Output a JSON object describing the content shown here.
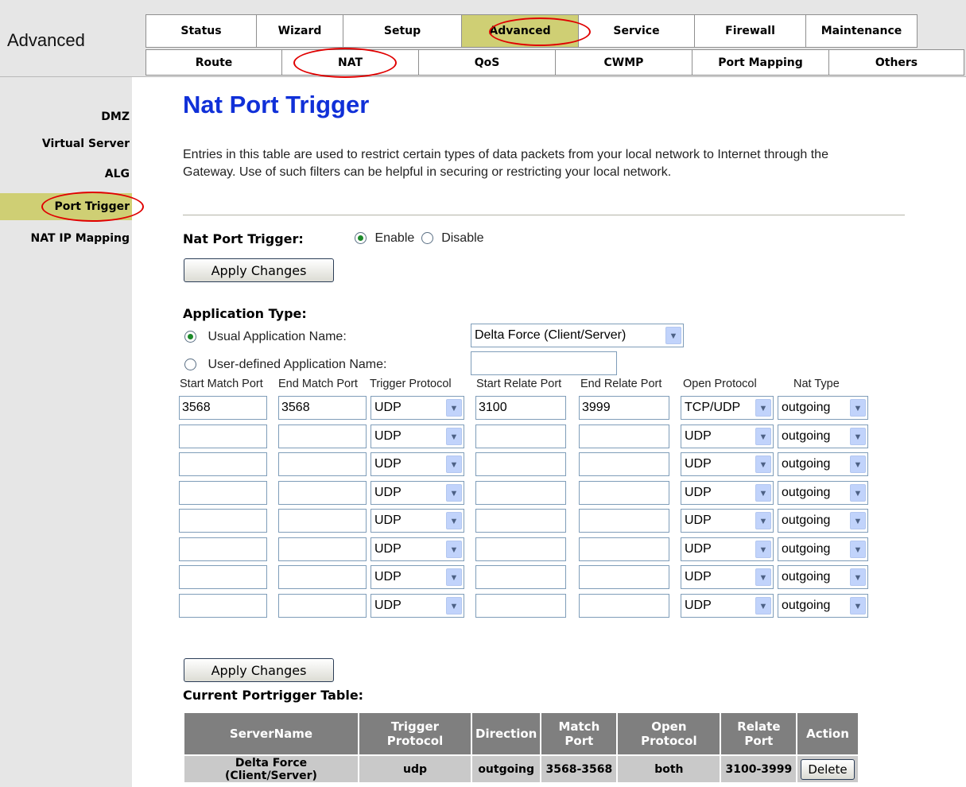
{
  "brand": {
    "label": "Advanced"
  },
  "topnav": {
    "main_tabs": [
      {
        "label": "Status"
      },
      {
        "label": "Wizard"
      },
      {
        "label": "Setup"
      },
      {
        "label": "Advanced",
        "active": true
      },
      {
        "label": "Service"
      },
      {
        "label": "Firewall"
      },
      {
        "label": "Maintenance"
      }
    ],
    "sub_tabs": [
      {
        "label": "Route"
      },
      {
        "label": "NAT",
        "active": true
      },
      {
        "label": "QoS"
      },
      {
        "label": "CWMP"
      },
      {
        "label": "Port Mapping"
      },
      {
        "label": "Others"
      }
    ]
  },
  "sidebar": {
    "items": [
      {
        "label": "DMZ"
      },
      {
        "label": "Virtual Server"
      },
      {
        "label": "ALG"
      },
      {
        "label": "Port Trigger",
        "active": true
      },
      {
        "label": "NAT IP Mapping"
      }
    ]
  },
  "page": {
    "title": "Nat Port Trigger",
    "description": "Entries in this table are used to restrict certain types of data packets from your local network to Internet through the Gateway. Use of such filters can be helpful in securing or restricting your local network."
  },
  "trigger": {
    "label": "Nat Port Trigger:",
    "enable_label": "Enable",
    "disable_label": "Disable",
    "selected": "Enable",
    "apply_label": "Apply Changes"
  },
  "app_type": {
    "heading": "Application Type:",
    "usual_label": "Usual Application Name:",
    "usual_value": "Delta Force (Client/Server)",
    "user_label": "User-defined Application Name:",
    "user_value": "",
    "selected": "usual"
  },
  "columns": [
    "Start Match Port",
    "End Match Port",
    "Trigger Protocol",
    "Start Relate Port",
    "End Relate Port",
    "Open Protocol",
    "Nat Type"
  ],
  "rows": [
    {
      "start_match": "3568",
      "end_match": "3568",
      "trigger_protocol": "UDP",
      "start_relate": "3100",
      "end_relate": "3999",
      "open_protocol": "TCP/UDP",
      "nat_type": "outgoing"
    },
    {
      "start_match": "",
      "end_match": "",
      "trigger_protocol": "UDP",
      "start_relate": "",
      "end_relate": "",
      "open_protocol": "UDP",
      "nat_type": "outgoing"
    },
    {
      "start_match": "",
      "end_match": "",
      "trigger_protocol": "UDP",
      "start_relate": "",
      "end_relate": "",
      "open_protocol": "UDP",
      "nat_type": "outgoing"
    },
    {
      "start_match": "",
      "end_match": "",
      "trigger_protocol": "UDP",
      "start_relate": "",
      "end_relate": "",
      "open_protocol": "UDP",
      "nat_type": "outgoing"
    },
    {
      "start_match": "",
      "end_match": "",
      "trigger_protocol": "UDP",
      "start_relate": "",
      "end_relate": "",
      "open_protocol": "UDP",
      "nat_type": "outgoing"
    },
    {
      "start_match": "",
      "end_match": "",
      "trigger_protocol": "UDP",
      "start_relate": "",
      "end_relate": "",
      "open_protocol": "UDP",
      "nat_type": "outgoing"
    },
    {
      "start_match": "",
      "end_match": "",
      "trigger_protocol": "UDP",
      "start_relate": "",
      "end_relate": "",
      "open_protocol": "UDP",
      "nat_type": "outgoing"
    },
    {
      "start_match": "",
      "end_match": "",
      "trigger_protocol": "UDP",
      "start_relate": "",
      "end_relate": "",
      "open_protocol": "UDP",
      "nat_type": "outgoing"
    }
  ],
  "apply2_label": "Apply Changes",
  "current_table": {
    "heading": "Current Portrigger Table:",
    "headers": [
      "ServerName",
      "Trigger Protocol",
      "Direction",
      "Match Port",
      "Open Protocol",
      "Relate Port",
      "Action"
    ],
    "rows": [
      {
        "server_name": "Delta Force (Client/Server)",
        "trigger_protocol": "udp",
        "direction": "outgoing",
        "match_port": "3568-3568",
        "open_protocol": "both",
        "relate_port": "3100-3999",
        "action_label": "Delete"
      }
    ]
  },
  "colors": {
    "accent_title": "#1030d8",
    "active_tab": "#cfcf74",
    "highlight_oval": "#e00000",
    "chrome_bg": "#e6e6e6",
    "table_header": "#7f7f7f",
    "table_cell": "#c9c9c9"
  }
}
